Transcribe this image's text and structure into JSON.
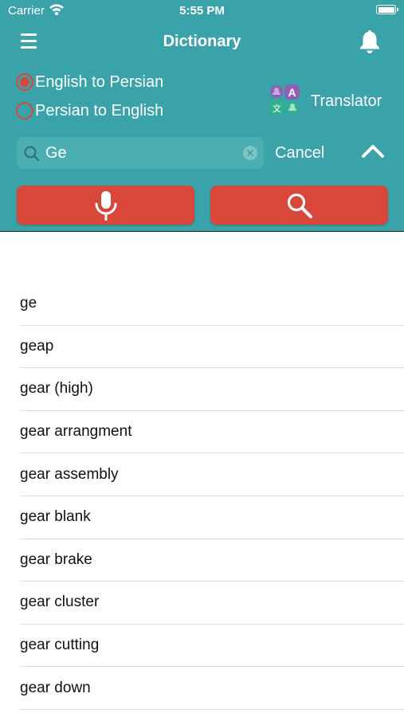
{
  "status_bar": {
    "carrier": "Carrier",
    "time": "5:55 PM"
  },
  "nav": {
    "title": "Dictionary"
  },
  "direction": {
    "options": [
      {
        "label": "English to Persian",
        "selected": true
      },
      {
        "label": "Persian to English",
        "selected": false
      }
    ]
  },
  "translator": {
    "label": "Translator"
  },
  "search": {
    "value": "Ge",
    "cancel_label": "Cancel"
  },
  "colors": {
    "header": "#3aa3a9",
    "accent": "#d9463a"
  },
  "results": [
    "ge",
    "geap",
    "gear (high)",
    "gear arrangment",
    "gear assembly",
    "gear blank",
    "gear brake",
    "gear cluster",
    "gear cutting",
    "gear down"
  ]
}
